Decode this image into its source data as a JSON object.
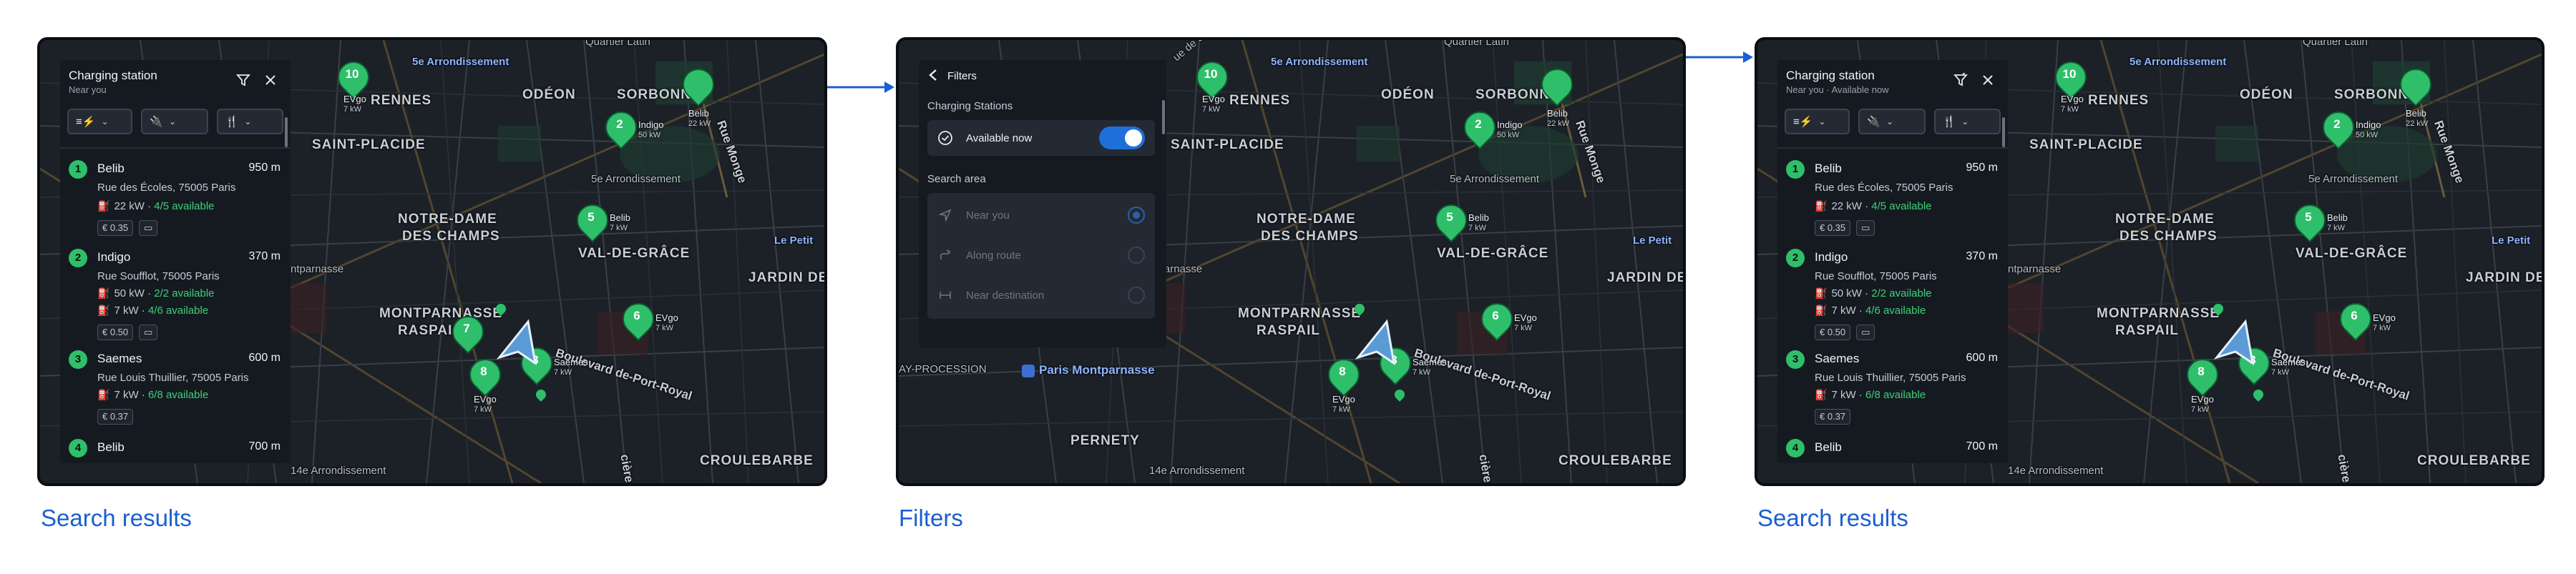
{
  "captions": [
    "Search results",
    "Filters",
    "Search results"
  ],
  "colors": {
    "accent_blue": "#1a5fd1",
    "station_green": "#2fbf6a",
    "available_text": "#3ecf78",
    "panel_bg": "#151a21",
    "map_bg": "#1b2027",
    "toggle_blue": "#1e6fd9"
  },
  "map": {
    "labels": {
      "quartier_latin": "Quartier Latin",
      "sixth_arr": "5e Arrondissement",
      "rennes": "RENNES",
      "odeon": "ODÉON",
      "sorbonne": "SORBONNE",
      "saint_placide": "SAINT-PLACIDE",
      "notre_dame_line1": "NOTRE-DAME",
      "notre_dame_line2": "DES CHAMPS",
      "val_de_grace": "VAL-DE-GRÂCE",
      "montparnasse": "MONTPARNASSE",
      "raspail": "RASPAIL",
      "le_petit": "Le Petit",
      "jardin_des": "JARDIN DES",
      "boulevard": "Boulevard de-Port-Royal",
      "croulebarbe": "CROULEBARBE",
      "fourteenth_arr": "14e Arrondissement",
      "montparnasse_partial": "ntparnasse",
      "vaugirard_partial": "ue de Sèvres",
      "procession": "AY-PROCESSION",
      "paris_montparnasse": "Paris Montparnasse",
      "pernety": "PERNETY",
      "rue_monge": "Rue Monge",
      "gare_partial": "cière"
    },
    "pins": [
      {
        "num": "10",
        "name": "EVgo",
        "power": "7 kW"
      },
      {
        "num": "",
        "name": "Belib",
        "power": "22 kW"
      },
      {
        "num": "2",
        "name": "Indigo",
        "power": "50 kW"
      },
      {
        "num": "5",
        "name": "Belib",
        "power": "7 kW"
      },
      {
        "num": "6",
        "name": "EVgo",
        "power": "7 kW"
      },
      {
        "num": "7",
        "name": "",
        "power": ""
      },
      {
        "num": "8",
        "name": "EVgo",
        "power": "7 kW"
      },
      {
        "num": "3",
        "name": "Saemes",
        "power": "7 kW"
      }
    ]
  },
  "search_panel": {
    "title": "Charging station",
    "subtitle": "Near you",
    "subtitle_filtered": "Near you · Available now",
    "filter_icon": "filter-icon",
    "close_icon": "close-icon",
    "chips": [
      {
        "icon": "sort-ev-icon"
      },
      {
        "icon": "plug-icon"
      },
      {
        "icon": "restaurant-icon"
      }
    ],
    "results": [
      {
        "num": "1",
        "name": "Belib",
        "distance": "950 m",
        "address": "Rue des Écoles, 75005 Paris",
        "connectors": [
          {
            "power": "22 kW · ",
            "avail": "4/5 available"
          }
        ],
        "badges": [
          "€ 0.35"
        ]
      },
      {
        "num": "2",
        "name": "Indigo",
        "distance": "370 m",
        "address": "Rue Soufflot, 75005 Paris",
        "connectors": [
          {
            "power": "50 kW · ",
            "avail": "2/2 available"
          },
          {
            "power": "7 kW · ",
            "avail": "4/6 available"
          }
        ],
        "badges": [
          "€ 0.50"
        ]
      },
      {
        "num": "3",
        "name": "Saemes",
        "distance": "600 m",
        "address": "Rue Louis Thuillier, 75005 Paris",
        "connectors": [
          {
            "power": "7 kW · ",
            "avail": "6/8 available"
          }
        ],
        "badges": [
          "€ 0.37"
        ]
      },
      {
        "num": "4",
        "name": "Belib",
        "distance": "700 m",
        "address": "",
        "connectors": [],
        "badges": []
      }
    ]
  },
  "filters_panel": {
    "title": "Filters",
    "section_stations": "Charging Stations",
    "available_now": "Available now",
    "section_area": "Search area",
    "area_options": [
      {
        "label": "Near you",
        "selected": true,
        "icon": "location-arrow-icon"
      },
      {
        "label": "Along route",
        "selected": false,
        "icon": "route-icon"
      },
      {
        "label": "Near destination",
        "selected": false,
        "icon": "destination-icon"
      }
    ]
  }
}
